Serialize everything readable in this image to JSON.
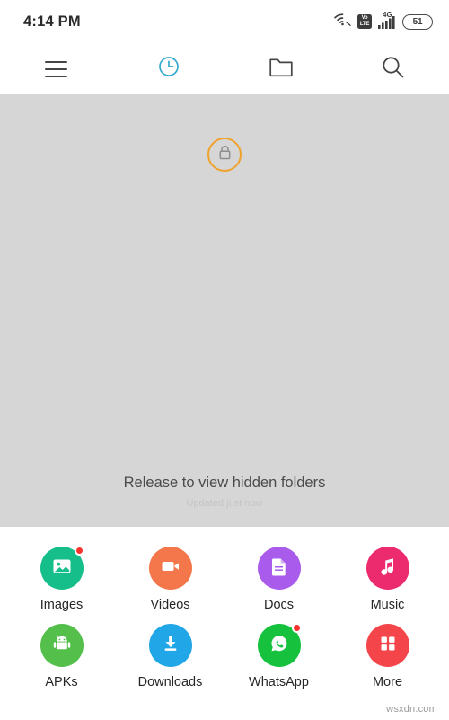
{
  "status_bar": {
    "time": "4:14 PM",
    "wifi_icon": "wifi-icon",
    "volte_line1": "Vo",
    "volte_line2": "LTE",
    "network_type": "4G",
    "signal_icon": "signal-bars-icon",
    "battery_level": "51"
  },
  "toolbar": {
    "items": [
      {
        "name": "menu-button",
        "icon": "hamburger-menu-icon",
        "active": false
      },
      {
        "name": "recent-tab",
        "icon": "clock-icon",
        "active": true
      },
      {
        "name": "folders-tab",
        "icon": "folder-icon",
        "active": false
      },
      {
        "name": "search-button",
        "icon": "search-icon",
        "active": false
      }
    ],
    "active_color": "#34a9cf",
    "inactive_color": "#454545"
  },
  "pull_panel": {
    "lock_icon": "padlock-icon",
    "lock_ring_color": "#f0a22e",
    "message": "Release to view hidden folders",
    "sub_message": "Updated just now",
    "background_color": "#d6d6d6"
  },
  "shortcuts": {
    "rows": [
      [
        {
          "label": "Images",
          "icon": "image-icon",
          "color": "#16bf8a",
          "badge": true
        },
        {
          "label": "Videos",
          "icon": "video-icon",
          "color": "#f4764b",
          "badge": false
        },
        {
          "label": "Docs",
          "icon": "document-icon",
          "color": "#a95cec",
          "badge": false
        },
        {
          "label": "Music",
          "icon": "music-note-icon",
          "color": "#ec2a6e",
          "badge": false
        }
      ],
      [
        {
          "label": "APKs",
          "icon": "android-icon",
          "color": "#54bf4a",
          "badge": false
        },
        {
          "label": "Downloads",
          "icon": "download-icon",
          "color": "#21a6e8",
          "badge": false
        },
        {
          "label": "WhatsApp",
          "icon": "whatsapp-icon",
          "color": "#16c13e",
          "badge": true
        },
        {
          "label": "More",
          "icon": "grid-icon",
          "color": "#f4464a",
          "badge": false
        }
      ]
    ]
  },
  "watermark": {
    "text": "wsxdn.com"
  }
}
